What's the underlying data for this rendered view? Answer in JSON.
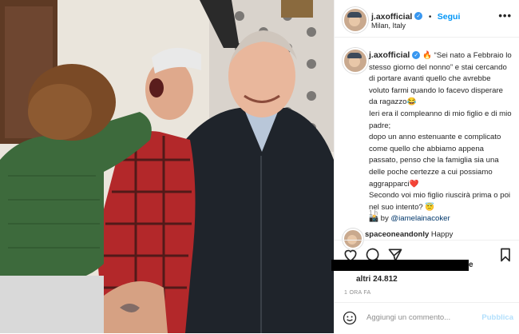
{
  "post": {
    "username": "j.axofficial",
    "verified_mark": "✓",
    "separator": "•",
    "follow_label": "Segui",
    "location": "Milan, Italy",
    "more_label": "•••"
  },
  "caption": {
    "username": "j.axofficial",
    "lines": [
      "🔥 “Sei nato a Febbraio lo stesso giorno del nonno” e stai cercando di portare avanti quello che avrebbe voluto farmi quando lo facevo disperare da ragazzo😂",
      "Ieri era il compleanno di mio figlio e di mio padre;",
      "dopo un anno estenuante e complicato come quello che abbiamo appena passato, penso che la famiglia sia una delle poche certezze a cui possiamo aggrapparci❤️",
      "Secondo voi mio figlio riuscirà prima o poi nel suo intento? 😇",
      "📸 by"
    ],
    "credit": "@iamelainacoker",
    "time": "1 h"
  },
  "comment": {
    "username": "spaceoneandonly",
    "text": "Happy"
  },
  "likes": {
    "text": "altri 24.812",
    "trail": "e"
  },
  "post_time": "1 ORA FA",
  "comment_box": {
    "placeholder": "Aggiungi un commento...",
    "publish_label": "Pubblica",
    "emoji_icon": "smiley-icon"
  },
  "icons": [
    "more-icon",
    "heart-icon",
    "comment-icon",
    "share-icon",
    "bookmark-icon",
    "verified-icon"
  ],
  "colors": {
    "accent": "#0095f6",
    "verified": "#3897f0",
    "muted": "#8e8e8e",
    "publish_disabled": "#b2dffc"
  }
}
